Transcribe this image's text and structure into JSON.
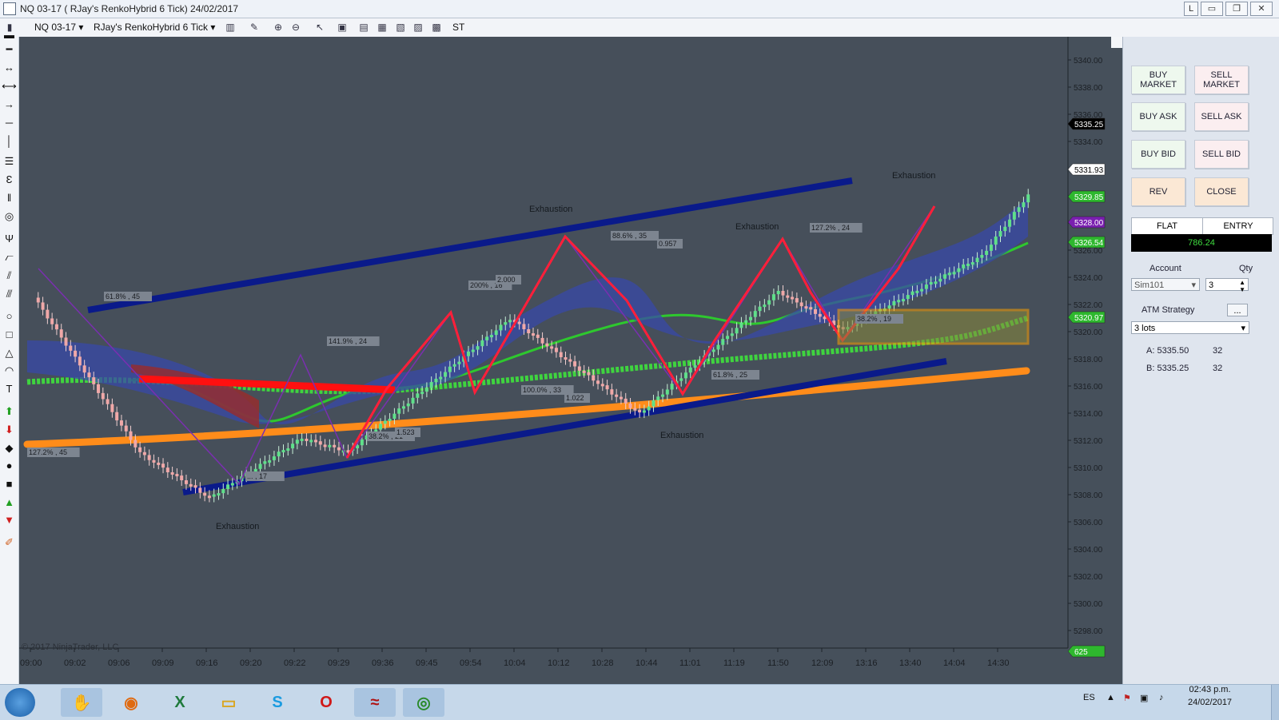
{
  "window": {
    "title": "NQ 03-17 ( RJay's RenkoHybrid  6 Tick)  24/02/2017",
    "buttons": {
      "l": "L",
      "minimize": "▭",
      "restore": "❐",
      "close": "✕"
    }
  },
  "toolbar": {
    "instrument": "NQ 03-17",
    "chart_type": "RJay's RenkoHybrid  6 Tick",
    "st_label": "ST"
  },
  "chart": {
    "copyright": "© 2017 NinjaTrader, LLC",
    "y_ticks": [
      "5340.00",
      "5338.00",
      "5336.00",
      "5334.00",
      "5332.00",
      "5330.00",
      "5328.00",
      "5326.00",
      "5324.00",
      "5322.00",
      "5320.00",
      "5318.00",
      "5316.00",
      "5314.00",
      "5312.00",
      "5310.00",
      "5308.00",
      "5306.00",
      "5304.00",
      "5302.00",
      "5300.00",
      "5298.00"
    ],
    "x_ticks": [
      "09:00",
      "09:02",
      "09:06",
      "09:09",
      "09:16",
      "09:20",
      "09:22",
      "09:29",
      "09:36",
      "09:45",
      "09:54",
      "10:04",
      "10:12",
      "10:28",
      "10:44",
      "11:01",
      "11:19",
      "11:50",
      "12:09",
      "13:16",
      "13:40",
      "14:04",
      "14:30"
    ],
    "price_markers": [
      {
        "label": "5335.25",
        "color": "#000000"
      },
      {
        "label": "5331.93",
        "color": "#ffffff"
      },
      {
        "label": "5329.85",
        "color": "#2eb82e"
      },
      {
        "label": "5328.00",
        "color": "#7a1fb0"
      },
      {
        "label": "5326.54",
        "color": "#2eb82e"
      },
      {
        "label": "5320.97",
        "color": "#2eb82e"
      },
      {
        "label": "625",
        "color": "#2eb82e"
      }
    ],
    "annotations": [
      {
        "text": "Exhaustion"
      },
      {
        "text": "Exhaustion"
      },
      {
        "text": "Exhaustion"
      },
      {
        "text": "Exhaustion"
      },
      {
        "text": "Exhaustion"
      }
    ],
    "fib_labels": [
      "61.8% , 45",
      "141.9% , 24",
      "200% , 16",
      "2.000",
      "88.6% , 35",
      "0.957",
      "127.2% , 24",
      "100.0% , 33",
      "1.022",
      "38.2% , 21",
      "1.523",
      "61.8% , 25",
      "38.2% , 19",
      "127.2% , 45",
      "... , 17"
    ],
    "colors": {
      "background": "#464f5a",
      "channel": "#0a1a8a",
      "up_bar": "#5fe08a",
      "down_bar": "#f0a8a8",
      "ema_orange": "#ff8c1a",
      "ema_green": "#3fd43f",
      "zigzag": "#ff1f3a"
    }
  },
  "panel": {
    "buy_market": "BUY MARKET",
    "sell_market": "SELL MARKET",
    "buy_ask": "BUY ASK",
    "sell_ask": "SELL ASK",
    "buy_bid": "BUY BID",
    "sell_bid": "SELL BID",
    "rev": "REV",
    "close": "CLOSE",
    "flat": "FLAT",
    "entry": "ENTRY",
    "pnl": "786.24",
    "account_label": "Account",
    "qty_label": "Qty",
    "account_value": "Sim101",
    "qty_value": "3",
    "atm_label": "ATM Strategy",
    "atm_value": "3 lots",
    "ask_label": "A: 5335.50",
    "ask_size": "32",
    "bid_label": "B: 5335.25",
    "bid_size": "32",
    "atm_more": "..."
  },
  "taskbar": {
    "lang": "ES",
    "time": "02:43 p.m.",
    "date": "24/02/2017"
  }
}
